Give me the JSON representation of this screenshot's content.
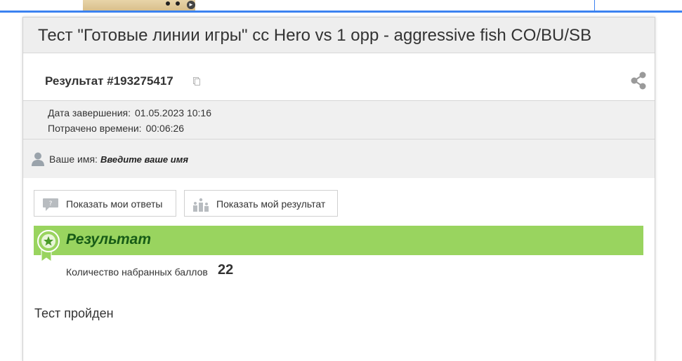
{
  "colors": {
    "accent_blue": "#3b82f0",
    "result_bar": "#99d45f",
    "result_title": "#175c17",
    "header_bg": "#eeeeee",
    "meta_bg": "#f0f0f0"
  },
  "test": {
    "title": "Тест \"Готовые линии игры\" cc Hero vs 1 opp - aggressive fish CO/BU/SB"
  },
  "result": {
    "id_label": "Результат #193275417",
    "copy_icon": "copy-icon",
    "share_icon": "share-icon"
  },
  "meta": {
    "completed_label": "Дата завершения:",
    "completed_value": "01.05.2023 10:16",
    "time_label": "Потрачено времени:",
    "time_value": "00:06:26"
  },
  "user": {
    "name_label": "Ваше имя:",
    "name_placeholder": "Введите ваше имя"
  },
  "buttons": {
    "show_answers": "Показать мои ответы",
    "show_result": "Показать мой результат"
  },
  "summary": {
    "title": "Результат",
    "score_label": "Количество набранных баллов",
    "score_value": "22",
    "status": "Тест пройден"
  }
}
